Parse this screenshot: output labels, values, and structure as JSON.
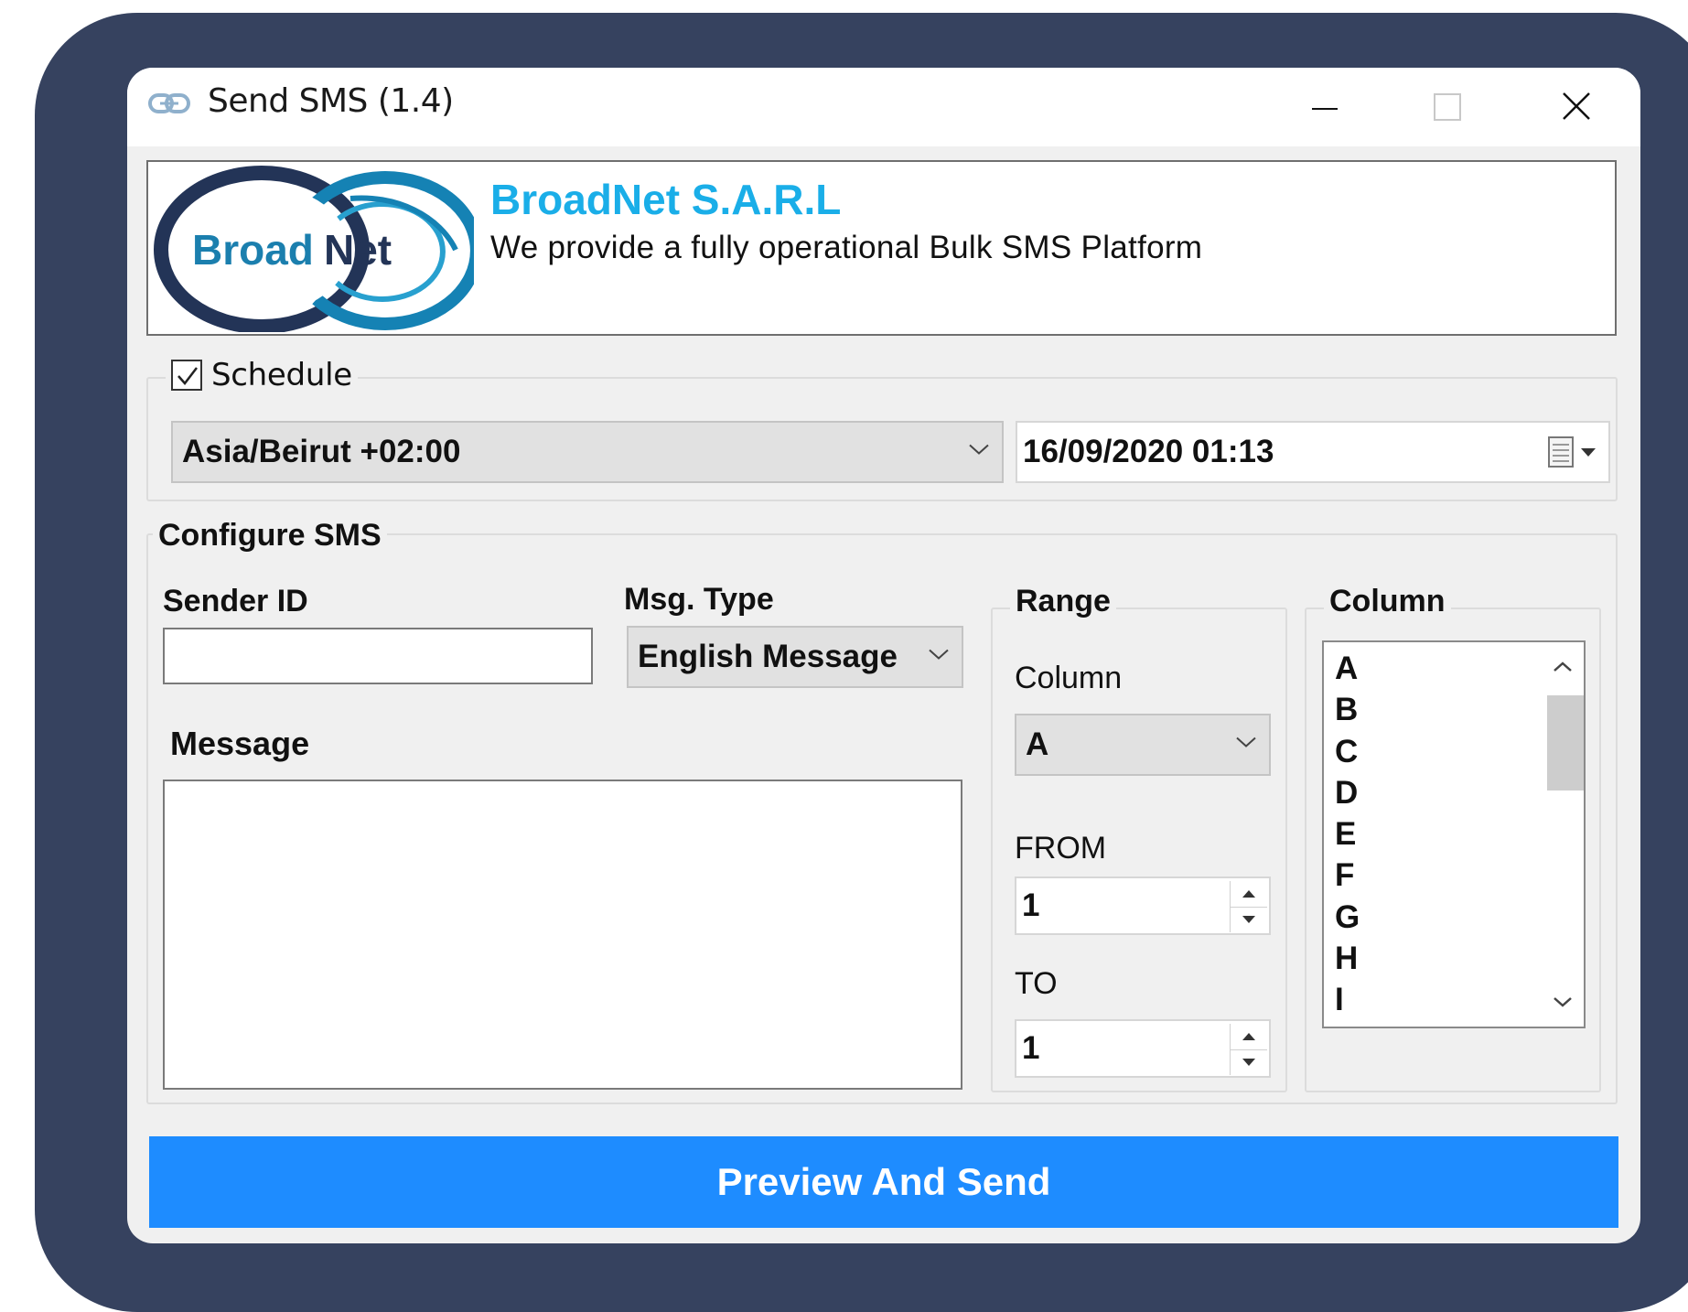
{
  "window": {
    "title": "Send SMS (1.4)",
    "controls": [
      "minimize-icon",
      "maximize-icon",
      "close-icon"
    ]
  },
  "banner": {
    "logo_text_1": "Broad",
    "logo_text_2": "Net",
    "company": "BroadNet S.A.R.L",
    "tagline": "We provide a fully operational Bulk SMS Platform"
  },
  "schedule": {
    "label": "Schedule",
    "checked": true,
    "timezone": "Asia/Beirut +02:00",
    "datetime": "16/09/2020 01:13"
  },
  "configure": {
    "title": "Configure SMS",
    "sender_label": "Sender ID",
    "sender_value": "",
    "msgtype_label": "Msg. Type",
    "msgtype_value": "English Message",
    "message_label": "Message",
    "message_value": ""
  },
  "range": {
    "title": "Range",
    "column_label": "Column",
    "column_value": "A",
    "from_label": "FROM",
    "from_value": "1",
    "to_label": "TO",
    "to_value": "1"
  },
  "column_list": {
    "title": "Column",
    "items": [
      "A",
      "B",
      "C",
      "D",
      "E",
      "F",
      "G",
      "H",
      "I"
    ]
  },
  "actions": {
    "send_label": "Preview And Send"
  },
  "colors": {
    "frame": "#36425f",
    "accent": "#1e8cff",
    "brand_blue": "#1aaee8",
    "brand_navy": "#2a3a5c"
  }
}
